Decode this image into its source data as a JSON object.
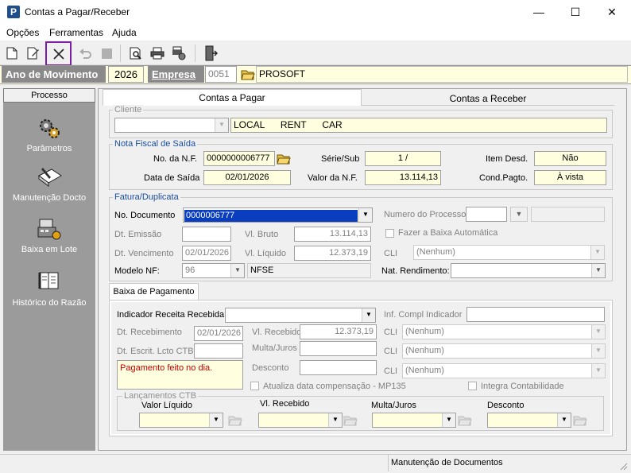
{
  "window": {
    "title": "Contas a Pagar/Receber",
    "minimize": "—",
    "maximize": "☐",
    "close": "✕"
  },
  "menu": [
    "Opções",
    "Ferramentas",
    "Ajuda"
  ],
  "header": {
    "ano_label": "Ano de Movimento",
    "ano_value": "2026",
    "empresa_label": "Empresa",
    "empresa_code": "0051",
    "empresa_name": "PROSOFT"
  },
  "sidebar": {
    "header": "Processo",
    "items": [
      {
        "label": "Parâmetros",
        "icon": "gears-icon"
      },
      {
        "label": "Manutenção Docto",
        "icon": "document-edit-icon"
      },
      {
        "label": "Baixa em Lote",
        "icon": "cash-register-icon"
      },
      {
        "label": "Histórico do Razão",
        "icon": "ledger-book-icon"
      }
    ]
  },
  "tabs": {
    "pagar": "Contas a Pagar",
    "receber": "Contas a Receber"
  },
  "cliente": {
    "title": "Cliente",
    "name": "LOCAL      RENT      CAR"
  },
  "nf": {
    "title": "Nota Fiscal de Saída",
    "numero_label": "No. da N.F.",
    "numero": "0000000006777",
    "serie_label": "Série/Sub",
    "serie": "1 /",
    "item_label": "Item Desd.",
    "item": "Não",
    "data_label": "Data de Saída",
    "data": "02/01/2026",
    "valor_label": "Valor da N.F.",
    "valor": "13.114,13",
    "cond_label": "Cond.Pagto.",
    "cond": "À vista"
  },
  "fatura": {
    "title": "Fatura/Duplicata",
    "nodoc_label": "No. Documento",
    "nodoc": "0000006777",
    "processo_label": "Numero do Processo",
    "emissao_label": "Dt. Emissão",
    "bruto_label": "Vl. Bruto",
    "bruto": "13.114,13",
    "baixa_auto_label": "Fazer a Baixa Automática",
    "venc_label": "Dt. Vencimento",
    "venc": "02/01/2026",
    "liquido_label": "Vl. Líquido",
    "liquido": "12.373,19",
    "cli_label": "CLI",
    "cli_value": "(Nenhum)",
    "modelo_label": "Modelo NF:",
    "modelo_code": "96",
    "modelo_name": "NFSE",
    "natrend_label": "Nat. Rendimento:"
  },
  "baixa": {
    "tab": "Baixa de Pagamento",
    "indicador_label": "Indicador Receita Recebida",
    "infcompl_label": "Inf. Compl Indicador",
    "receb_label": "Dt. Recebimento",
    "receb": "02/01/2026",
    "vlreceb_label": "Vl. Recebido",
    "vlreceb": "12.373,19",
    "cli1_label": "CLI",
    "cli1": "(Nenhum)",
    "escrit_label": "Dt. Escrit. Lcto CTB",
    "multa_label": "Multa/Juros",
    "cli2_label": "CLI",
    "cli2": "(Nenhum)",
    "memo": "Pagamento feito no dia.",
    "desconto_label": "Desconto",
    "cli3_label": "CLI",
    "cli3": "(Nenhum)",
    "atualiza_label": "Atualiza data compensação - MP135",
    "integra_label": "Integra Contabilidade",
    "lanc_title": "Lançamentos CTB",
    "col_liquido": "Valor Líquido",
    "col_receb": "Vl. Recebido",
    "col_multa": "Multa/Juros",
    "col_desconto": "Desconto"
  },
  "status": {
    "text": "Manutenção de Documentos"
  },
  "colors": {
    "header_band": "#fffde0",
    "sidebar": "#9b9b9b",
    "selection": "#0a3ebf",
    "memo_text": "#c00000",
    "highlight_border": "#7a1fa2"
  }
}
